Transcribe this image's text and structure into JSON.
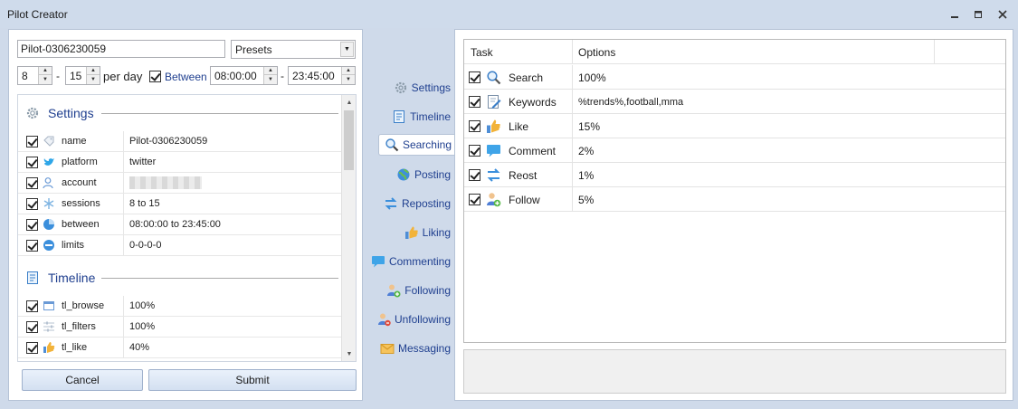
{
  "window": {
    "title": "Pilot Creator"
  },
  "form": {
    "pilot_name": "Pilot-0306230059",
    "presets": "Presets",
    "sessions_min": "8",
    "sessions_max": "15",
    "dash1": "-",
    "dash2": "-",
    "per_day": "per day",
    "between_label": "Between",
    "between_checked": true,
    "time_start": "08:00:00",
    "time_end": "23:45:00"
  },
  "settings_list": {
    "sections": [
      {
        "name": "Settings",
        "icon": "gear-icon",
        "rows": [
          {
            "key": "name",
            "value": "Pilot-0306230059",
            "icon": "tag-icon"
          },
          {
            "key": "platform",
            "value": "twitter",
            "icon": "twitter-bird-icon"
          },
          {
            "key": "account",
            "value": "",
            "icon": "user-icon"
          },
          {
            "key": "sessions",
            "value": "8 to 15",
            "icon": "sessions-icon"
          },
          {
            "key": "between",
            "value": "08:00:00 to 23:45:00",
            "icon": "pie-clock-icon"
          },
          {
            "key": "limits",
            "value": "0-0-0-0",
            "icon": "minus-circle-icon"
          }
        ]
      },
      {
        "name": "Timeline",
        "icon": "document-icon",
        "rows": [
          {
            "key": "tl_browse",
            "value": "100%",
            "icon": "browser-window-icon"
          },
          {
            "key": "tl_filters",
            "value": "100%",
            "icon": "filter-sliders-icon"
          },
          {
            "key": "tl_like",
            "value": "40%",
            "icon": "thumbs-up-icon"
          }
        ]
      }
    ]
  },
  "buttons": {
    "cancel": "Cancel",
    "submit": "Submit"
  },
  "nav": [
    {
      "label": "Settings",
      "icon": "gear-icon",
      "active": false
    },
    {
      "label": "Timeline",
      "icon": "document-icon",
      "active": false
    },
    {
      "label": "Searching",
      "icon": "magnifier-icon",
      "active": true
    },
    {
      "label": "Posting",
      "icon": "globe-icon",
      "active": false
    },
    {
      "label": "Reposting",
      "icon": "repost-arrows-icon",
      "active": false
    },
    {
      "label": "Liking",
      "icon": "thumbs-up-icon",
      "active": false
    },
    {
      "label": "Commenting",
      "icon": "speech-bubble-icon",
      "active": false
    },
    {
      "label": "Following",
      "icon": "add-user-icon",
      "active": false
    },
    {
      "label": "Unfollowing",
      "icon": "remove-user-icon",
      "active": false
    },
    {
      "label": "Messaging",
      "icon": "envelope-icon",
      "active": false
    }
  ],
  "task_grid": {
    "headers": {
      "task": "Task",
      "options": "Options"
    },
    "rows": [
      {
        "task": "Search",
        "options": "100%",
        "icon": "magnifier-icon",
        "checked": true
      },
      {
        "task": "Keywords",
        "options": "%trends%,football,mma",
        "icon": "edit-document-icon",
        "checked": true
      },
      {
        "task": "Like",
        "options": "15%",
        "icon": "thumbs-up-icon",
        "checked": true
      },
      {
        "task": "Comment",
        "options": "2%",
        "icon": "speech-bubble-icon",
        "checked": true
      },
      {
        "task": "Reost",
        "options": "1%",
        "icon": "repost-arrows-icon",
        "checked": true
      },
      {
        "task": "Follow",
        "options": "5%",
        "icon": "add-user-icon",
        "checked": true
      }
    ]
  },
  "colors": {
    "accent": "#1f3f8f",
    "window_bg": "#cfdaea",
    "panel_border": "#b5c3d6"
  }
}
